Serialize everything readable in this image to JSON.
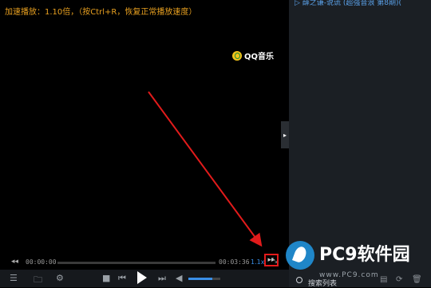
{
  "player": {
    "osd_message": "加速播放：1.10倍，（按Ctrl+R，恢复正常播放速度）",
    "logo_text": "QQ音乐"
  },
  "sidebar": {
    "playlist_item": "▷ 薛之谦-说谎 (超强音浪 第8期)(",
    "collapse_arrow": "▸",
    "search_list_label": "搜索列表"
  },
  "progress": {
    "elapsed": "00:00:00",
    "duration": "00:03:36",
    "speed": "1.1x",
    "rewind_icon": "◂◂",
    "ff_icon": "▸▸",
    "fullscreen_icon": "⤡"
  },
  "controls": {
    "menu_icon": "☰",
    "folder_icon": "🗀",
    "settings_icon": "⚙",
    "stop_icon": "■",
    "prev_icon": "⏮",
    "next_icon": "⏭",
    "volume_icon": "◀",
    "volume_level": 0.75
  },
  "watermark": {
    "title": "PC9软件园",
    "url": "www.PC9.com"
  },
  "colors": {
    "osd": "#e8a020",
    "accent": "#3a8ee6",
    "highlight_box": "#e21b1b",
    "arrow": "#e21b1b"
  }
}
